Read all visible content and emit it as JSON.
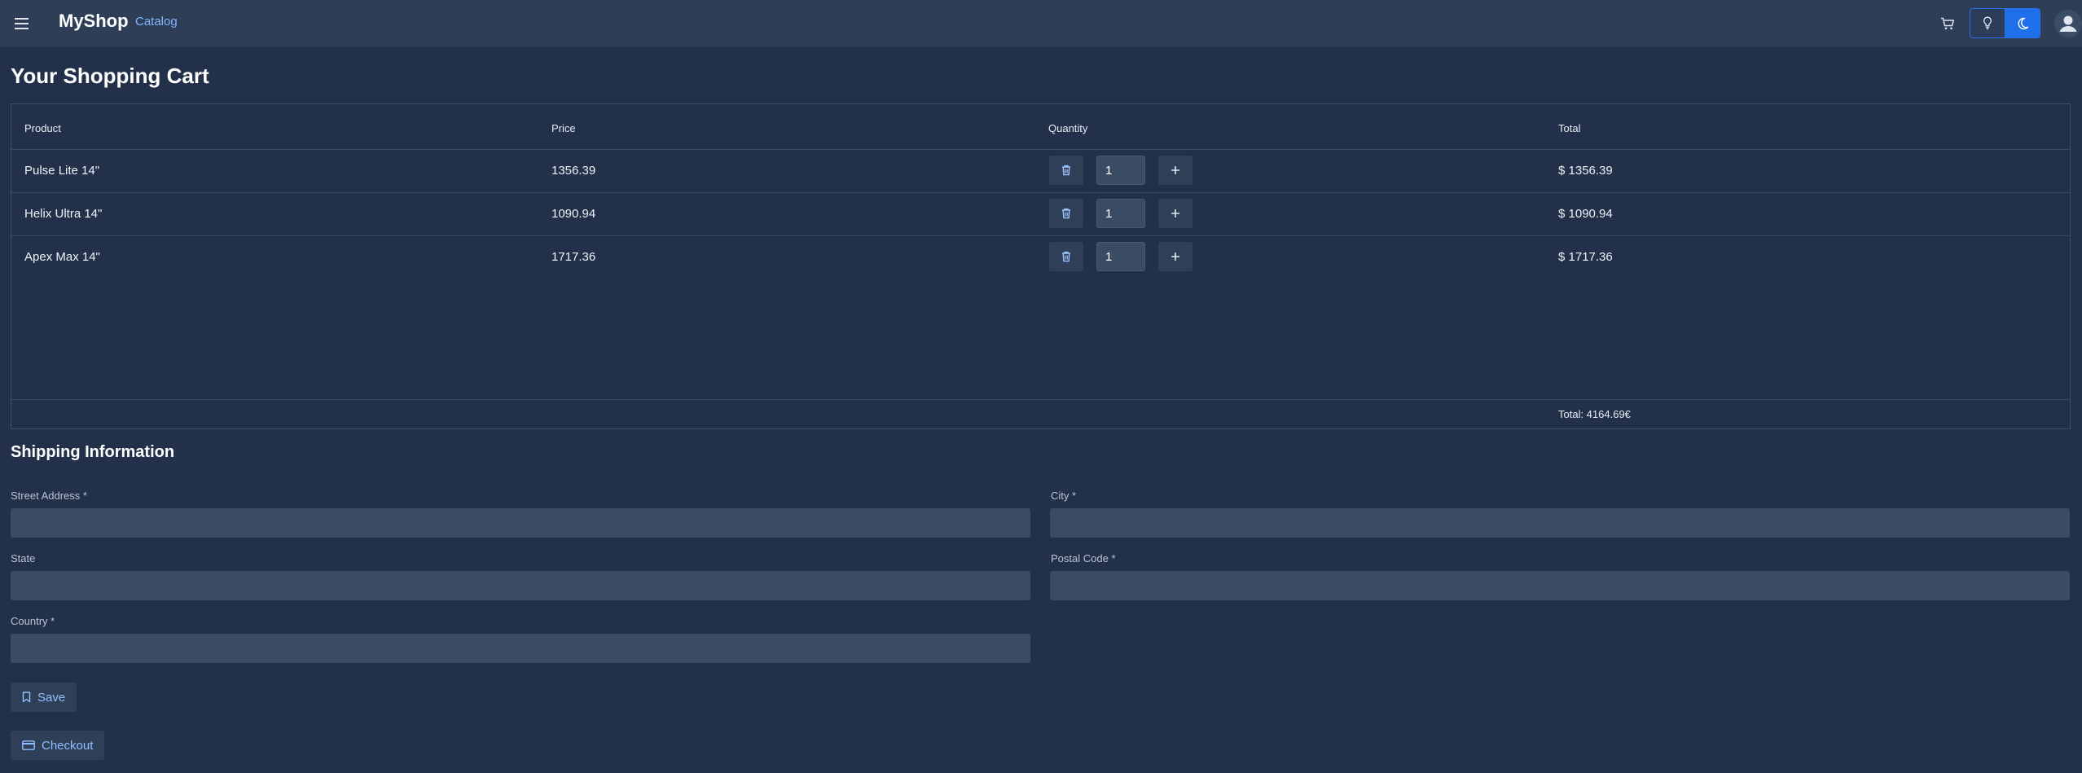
{
  "header": {
    "brand": "MyShop",
    "nav_catalog": "Catalog",
    "icons": [
      "menu-icon",
      "cart-icon",
      "lightbulb-icon",
      "moon-icon",
      "user-avatar-icon"
    ]
  },
  "cart": {
    "title": "Your Shopping Cart",
    "columns": [
      "Product",
      "Price",
      "Quantity",
      "Total"
    ],
    "rows": [
      {
        "product": "Pulse Lite 14\"",
        "price": "1356.39",
        "quantity": "1",
        "total": "$ 1356.39"
      },
      {
        "product": "Helix Ultra 14\"",
        "price": "1090.94",
        "quantity": "1",
        "total": "$ 1090.94"
      },
      {
        "product": "Apex Max 14\"",
        "price": "1717.36",
        "quantity": "1",
        "total": "$ 1717.36"
      }
    ],
    "grand_total": "Total: 4164.69€"
  },
  "shipping": {
    "title": "Shipping Information",
    "fields": {
      "street": {
        "label": "Street Address",
        "required": "*",
        "value": ""
      },
      "city": {
        "label": "City",
        "required": "*",
        "value": ""
      },
      "state": {
        "label": "State",
        "required": "",
        "value": ""
      },
      "postal": {
        "label": "Postal Code",
        "required": "*",
        "value": ""
      },
      "country": {
        "label": "Country",
        "required": "*",
        "value": ""
      }
    },
    "save_label": "Save",
    "checkout_label": "Checkout"
  },
  "colors": {
    "background": "#223149",
    "header": "#2e3e56",
    "accent": "#1f6fea",
    "link": "#7fb5ff"
  }
}
